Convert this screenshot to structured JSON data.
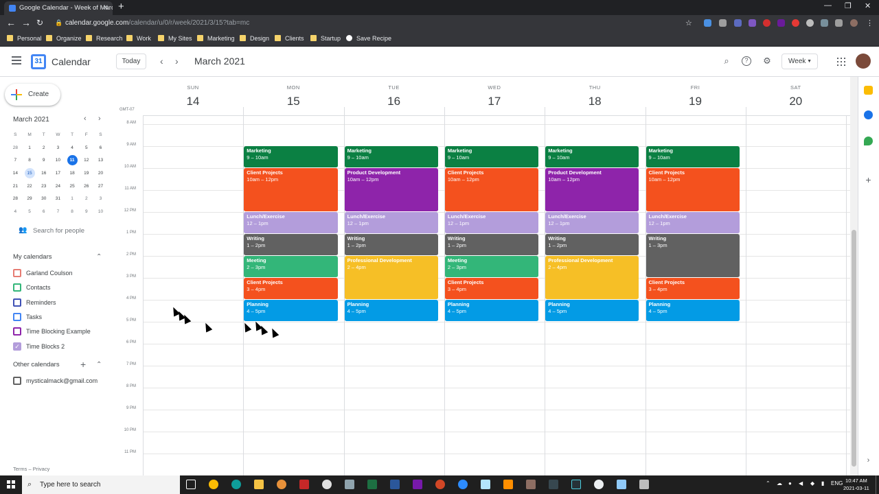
{
  "browser": {
    "tab_title": "Google Calendar - Week of Marc",
    "url_domain": "calendar.google.com",
    "url_path": "/calendar/u/0/r/week/2021/3/15?tab=mc",
    "bookmarks": [
      "Personal",
      "Organize",
      "Research",
      "Work",
      "My Sites",
      "Marketing",
      "Design",
      "Clients",
      "Startup",
      "Save Recipe"
    ]
  },
  "header": {
    "app_name": "Calendar",
    "today_label": "Today",
    "month_title": "March 2021",
    "view_label": "Week"
  },
  "sidebar": {
    "create_label": "Create",
    "mini_month": "March 2021",
    "dow": [
      "S",
      "M",
      "T",
      "W",
      "T",
      "F",
      "S"
    ],
    "weeks": [
      [
        "28",
        "1",
        "2",
        "3",
        "4",
        "5",
        "6"
      ],
      [
        "7",
        "8",
        "9",
        "10",
        "11",
        "12",
        "13"
      ],
      [
        "14",
        "15",
        "16",
        "17",
        "18",
        "19",
        "20"
      ],
      [
        "21",
        "22",
        "23",
        "24",
        "25",
        "26",
        "27"
      ],
      [
        "28",
        "29",
        "30",
        "31",
        "1",
        "2",
        "3"
      ],
      [
        "4",
        "5",
        "6",
        "7",
        "8",
        "9",
        "10"
      ]
    ],
    "search_people": "Search for people",
    "my_calendars_title": "My calendars",
    "my_calendars": [
      {
        "name": "Garland Coulson",
        "color": "#e67c73",
        "checked": false
      },
      {
        "name": "Contacts",
        "color": "#33b679",
        "checked": false
      },
      {
        "name": "Reminders",
        "color": "#3f51b5",
        "checked": false
      },
      {
        "name": "Tasks",
        "color": "#4285f4",
        "checked": false
      },
      {
        "name": "Time Blocking Example",
        "color": "#8e24aa",
        "checked": false
      },
      {
        "name": "Time Blocks 2",
        "color": "#b39ddb",
        "checked": true
      }
    ],
    "other_calendars_title": "Other calendars",
    "other_calendars": [
      {
        "name": "mysticalmack@gmail.com",
        "color": "#616161",
        "checked": false
      }
    ],
    "footer": "Terms – Privacy"
  },
  "week": {
    "timezone": "GMT-07",
    "days": [
      {
        "dow": "SUN",
        "num": "14"
      },
      {
        "dow": "MON",
        "num": "15"
      },
      {
        "dow": "TUE",
        "num": "16"
      },
      {
        "dow": "WED",
        "num": "17"
      },
      {
        "dow": "THU",
        "num": "18"
      },
      {
        "dow": "FRI",
        "num": "19"
      },
      {
        "dow": "SAT",
        "num": "20"
      }
    ],
    "hours": [
      "8 AM",
      "9 AM",
      "10 AM",
      "11 AM",
      "12 PM",
      "1 PM",
      "2 PM",
      "3 PM",
      "4 PM",
      "5 PM",
      "6 PM",
      "7 PM",
      "8 PM",
      "9 PM",
      "10 PM",
      "11 PM"
    ],
    "first_hour": 8,
    "events": [
      {
        "day": 1,
        "start": 9,
        "end": 10,
        "title": "Marketing",
        "time": "9 – 10am",
        "color": "#0b8043"
      },
      {
        "day": 1,
        "start": 10,
        "end": 12,
        "title": "Client Projects",
        "time": "10am – 12pm",
        "color": "#f4511e"
      },
      {
        "day": 1,
        "start": 12,
        "end": 13,
        "title": "Lunch/Exercise",
        "time": "12 – 1pm",
        "color": "#b39ddb"
      },
      {
        "day": 1,
        "start": 13,
        "end": 14,
        "title": "Writing",
        "time": "1 – 2pm",
        "color": "#616161"
      },
      {
        "day": 1,
        "start": 14,
        "end": 15,
        "title": "Meeting",
        "time": "2 – 3pm",
        "color": "#33b679"
      },
      {
        "day": 1,
        "start": 15,
        "end": 16,
        "title": "Client Projects",
        "time": "3 – 4pm",
        "color": "#f4511e"
      },
      {
        "day": 1,
        "start": 16,
        "end": 17,
        "title": "Planning",
        "time": "4 – 5pm",
        "color": "#039be5"
      },
      {
        "day": 2,
        "start": 9,
        "end": 10,
        "title": "Marketing",
        "time": "9 – 10am",
        "color": "#0b8043"
      },
      {
        "day": 2,
        "start": 10,
        "end": 12,
        "title": "Product Development",
        "time": "10am – 12pm",
        "color": "#8e24aa"
      },
      {
        "day": 2,
        "start": 12,
        "end": 13,
        "title": "Lunch/Exercise",
        "time": "12 – 1pm",
        "color": "#b39ddb"
      },
      {
        "day": 2,
        "start": 13,
        "end": 14,
        "title": "Writing",
        "time": "1 – 2pm",
        "color": "#616161"
      },
      {
        "day": 2,
        "start": 14,
        "end": 16,
        "title": "Professional Development",
        "time": "2 – 4pm",
        "color": "#f6bf26"
      },
      {
        "day": 2,
        "start": 16,
        "end": 17,
        "title": "Planning",
        "time": "4 – 5pm",
        "color": "#039be5"
      },
      {
        "day": 3,
        "start": 9,
        "end": 10,
        "title": "Marketing",
        "time": "9 – 10am",
        "color": "#0b8043"
      },
      {
        "day": 3,
        "start": 10,
        "end": 12,
        "title": "Client Projects",
        "time": "10am – 12pm",
        "color": "#f4511e"
      },
      {
        "day": 3,
        "start": 12,
        "end": 13,
        "title": "Lunch/Exercise",
        "time": "12 – 1pm",
        "color": "#b39ddb"
      },
      {
        "day": 3,
        "start": 13,
        "end": 14,
        "title": "Writing",
        "time": "1 – 2pm",
        "color": "#616161"
      },
      {
        "day": 3,
        "start": 14,
        "end": 15,
        "title": "Meeting",
        "time": "2 – 3pm",
        "color": "#33b679"
      },
      {
        "day": 3,
        "start": 15,
        "end": 16,
        "title": "Client Projects",
        "time": "3 – 4pm",
        "color": "#f4511e"
      },
      {
        "day": 3,
        "start": 16,
        "end": 17,
        "title": "Planning",
        "time": "4 – 5pm",
        "color": "#039be5"
      },
      {
        "day": 4,
        "start": 9,
        "end": 10,
        "title": "Marketing",
        "time": "9 – 10am",
        "color": "#0b8043"
      },
      {
        "day": 4,
        "start": 10,
        "end": 12,
        "title": "Product Development",
        "time": "10am – 12pm",
        "color": "#8e24aa"
      },
      {
        "day": 4,
        "start": 12,
        "end": 13,
        "title": "Lunch/Exercise",
        "time": "12 – 1pm",
        "color": "#b39ddb"
      },
      {
        "day": 4,
        "start": 13,
        "end": 14,
        "title": "Writing",
        "time": "1 – 2pm",
        "color": "#616161"
      },
      {
        "day": 4,
        "start": 14,
        "end": 16,
        "title": "Professional Development",
        "time": "2 – 4pm",
        "color": "#f6bf26"
      },
      {
        "day": 4,
        "start": 16,
        "end": 17,
        "title": "Planning",
        "time": "4 – 5pm",
        "color": "#039be5"
      },
      {
        "day": 5,
        "start": 9,
        "end": 10,
        "title": "Marketing",
        "time": "9 – 10am",
        "color": "#0b8043"
      },
      {
        "day": 5,
        "start": 10,
        "end": 12,
        "title": "Client Projects",
        "time": "10am – 12pm",
        "color": "#f4511e"
      },
      {
        "day": 5,
        "start": 12,
        "end": 13,
        "title": "Lunch/Exercise",
        "time": "12 – 1pm",
        "color": "#b39ddb"
      },
      {
        "day": 5,
        "start": 13,
        "end": 15,
        "title": "Writing",
        "time": "1 – 3pm",
        "color": "#616161"
      },
      {
        "day": 5,
        "start": 15,
        "end": 16,
        "title": "Client Projects",
        "time": "3 – 4pm",
        "color": "#f4511e"
      },
      {
        "day": 5,
        "start": 16,
        "end": 17,
        "title": "Planning",
        "time": "4 – 5pm",
        "color": "#039be5"
      }
    ]
  },
  "taskbar": {
    "search_placeholder": "Type here to search",
    "lang": "ENG",
    "time": "10:47 AM",
    "date": "2021-03-11"
  }
}
